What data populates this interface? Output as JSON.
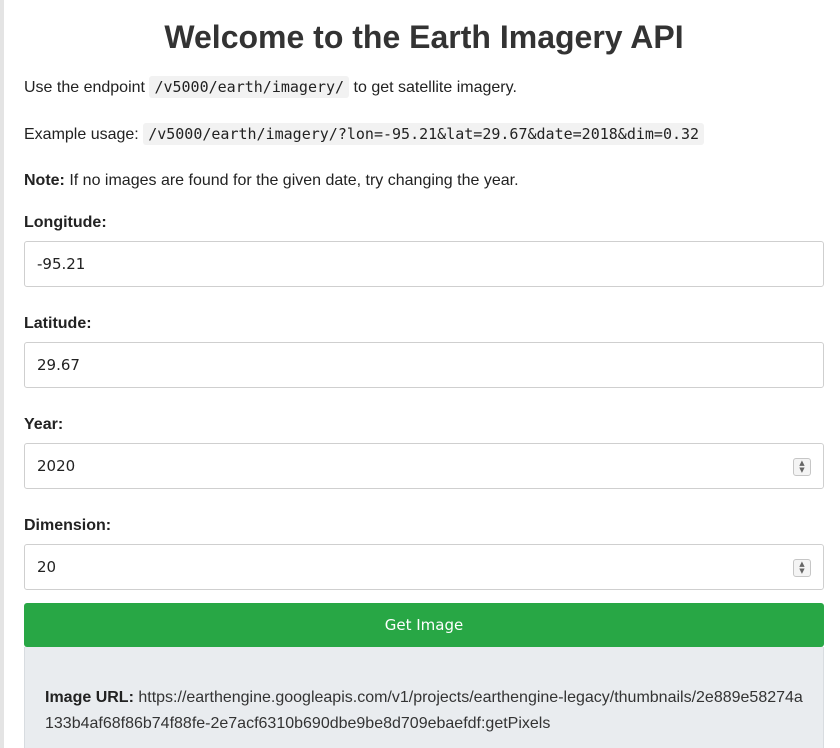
{
  "page": {
    "title": "Welcome to the Earth Imagery API"
  },
  "intro": {
    "endpoint_prefix": "Use the endpoint",
    "endpoint_code": "/v5000/earth/imagery/",
    "endpoint_suffix": "to get satellite imagery.",
    "example_prefix": "Example usage:",
    "example_code": "/v5000/earth/imagery/?lon=-95.21&lat=29.67&date=2018&dim=0.32",
    "note_label": "Note:",
    "note_text": "If no images are found for the given date, try changing the year."
  },
  "form": {
    "longitude_label": "Longitude:",
    "longitude_value": "-95.21",
    "latitude_label": "Latitude:",
    "latitude_value": "29.67",
    "year_label": "Year:",
    "year_value": "2020",
    "dimension_label": "Dimension:",
    "dimension_value": "20",
    "submit_label": "Get Image"
  },
  "result": {
    "url_label": "Image URL:",
    "url_value": "https://earthengine.googleapis.com/v1/projects/earthengine-legacy/thumbnails/2e889e58274a133b4af68f86b74f88fe-2e7acf6310b690dbe9be8d709ebaefdf:getPixels"
  },
  "icons": {
    "spinner_up": "chevron-up-icon",
    "spinner_down": "chevron-down-icon"
  },
  "colors": {
    "button": "#28a745",
    "result_background": "#e9ecef"
  }
}
